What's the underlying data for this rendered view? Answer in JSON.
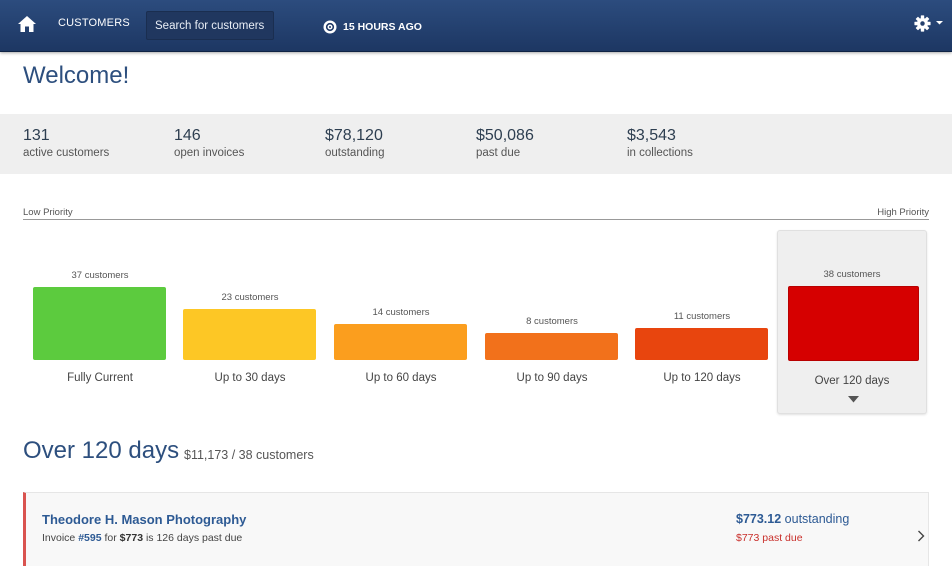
{
  "topbar": {
    "nav_customers": "CUSTOMERS",
    "search_placeholder": "Search for customers",
    "sync_text": "15 HOURS AGO"
  },
  "page": {
    "welcome": "Welcome!"
  },
  "stats": [
    {
      "value": "131",
      "label": "active customers"
    },
    {
      "value": "146",
      "label": "open invoices"
    },
    {
      "value": "$78,120",
      "label": "outstanding"
    },
    {
      "value": "$50,086",
      "label": "past due"
    },
    {
      "value": "$3,543",
      "label": "in collections"
    }
  ],
  "priority": {
    "low": "Low Priority",
    "high": "High Priority"
  },
  "buckets": [
    {
      "count_text": "37 customers",
      "label": "Fully Current",
      "color": "#5ccb3e",
      "customers": 37
    },
    {
      "count_text": "23 customers",
      "label": "Up to 30 days",
      "color": "#fdc725",
      "customers": 23
    },
    {
      "count_text": "14 customers",
      "label": "Up to 60 days",
      "color": "#fb9e1e",
      "customers": 14
    },
    {
      "count_text": "8 customers",
      "label": "Up to 90 days",
      "color": "#f2711b",
      "customers": 8
    },
    {
      "count_text": "11 customers",
      "label": "Up to 120 days",
      "color": "#e8450e",
      "customers": 11
    },
    {
      "count_text": "38 customers",
      "label": "Over 120 days",
      "color": "#d60000",
      "customers": 38,
      "selected": true
    }
  ],
  "section": {
    "title": "Over 120 days",
    "subtitle": "$11,173 / 38 customers"
  },
  "customer": {
    "name": "Theodore H. Mason Photography",
    "invoice_prefix": "Invoice",
    "invoice_number": "#595",
    "for_text": "for",
    "amount": "$773",
    "days_text": "is 126 days past due",
    "outstanding_amount": "$773.12",
    "outstanding_label": "outstanding",
    "past_due": "$773 past due"
  }
}
